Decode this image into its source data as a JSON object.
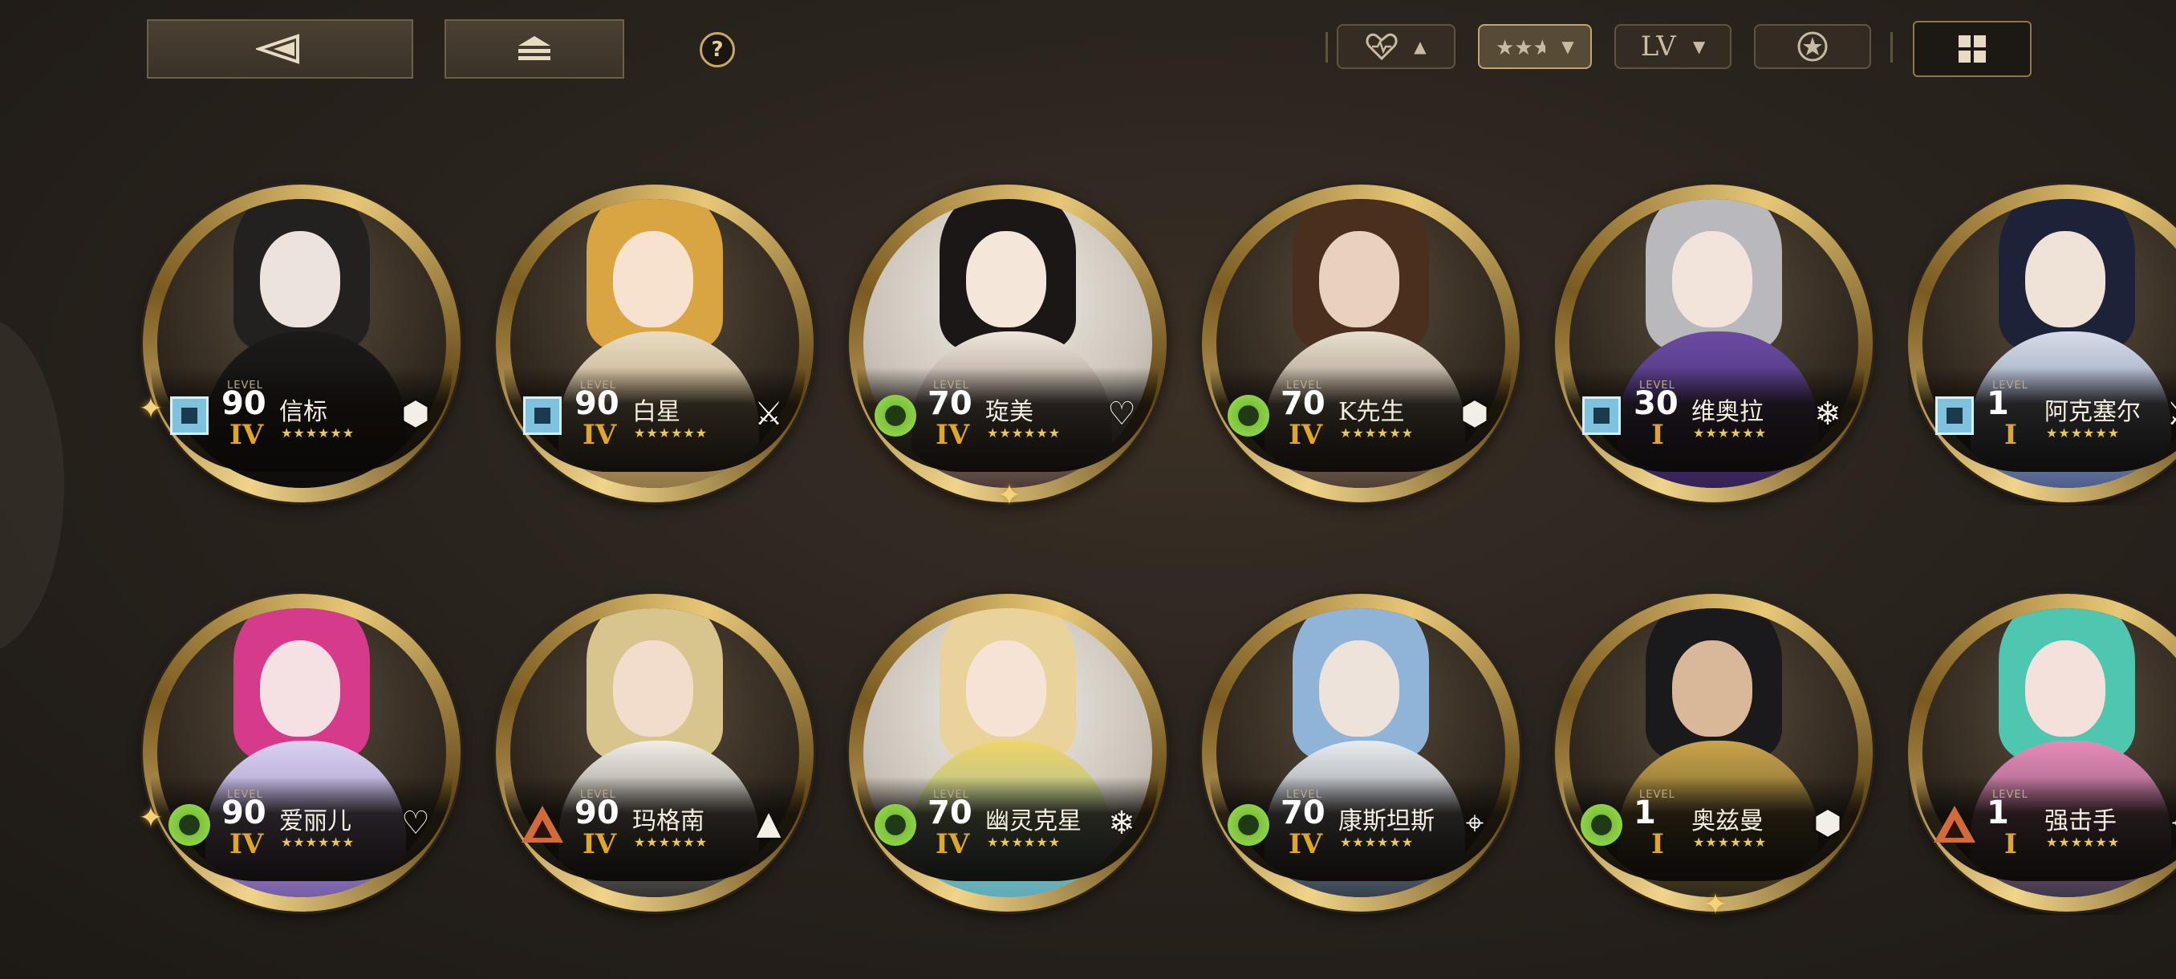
{
  "topbar": {
    "sort_level_label": "LV",
    "icons": {
      "back": "back-arrow-icon",
      "home": "home-stack-icon",
      "help": "help-icon",
      "affinity": "heart-icon",
      "rarity": "stars-icon",
      "type": "star-badge-icon",
      "grid": "grid-view-icon"
    },
    "help_glyph": "?"
  },
  "level_caption": "LEVEL",
  "characters": [
    {
      "name": "信标",
      "level": "90",
      "rank": "IV",
      "stars": "★★★★★★",
      "element": "square",
      "class_icon": "hexagon-icon"
    },
    {
      "name": "白星",
      "level": "90",
      "rank": "IV",
      "stars": "★★★★★★",
      "element": "square",
      "class_icon": "crossed-blades-icon"
    },
    {
      "name": "琁美",
      "level": "70",
      "rank": "IV",
      "stars": "★★★★★★",
      "element": "circle",
      "class_icon": "heart-icon"
    },
    {
      "name": "K先生",
      "level": "70",
      "rank": "IV",
      "stars": "★★★★★★",
      "element": "circle",
      "class_icon": "hexagon-icon"
    },
    {
      "name": "维奥拉",
      "level": "30",
      "rank": "I",
      "stars": "★★★★★★",
      "element": "square",
      "class_icon": "snowflake-icon"
    },
    {
      "name": "阿克塞尔",
      "level": "1",
      "rank": "I",
      "stars": "★★★★★★",
      "element": "square",
      "class_icon": "crossed-blades-icon"
    },
    {
      "name": "爱丽儿",
      "level": "90",
      "rank": "IV",
      "stars": "★★★★★★",
      "element": "circle",
      "class_icon": "heart-icon"
    },
    {
      "name": "玛格南",
      "level": "90",
      "rank": "IV",
      "stars": "★★★★★★",
      "element": "triangle",
      "class_icon": "pyramid-icon"
    },
    {
      "name": "幽灵克星",
      "level": "70",
      "rank": "IV",
      "stars": "★★★★★★",
      "element": "circle",
      "class_icon": "snowflake-icon"
    },
    {
      "name": "康斯坦斯",
      "level": "70",
      "rank": "IV",
      "stars": "★★★★★★",
      "element": "circle",
      "class_icon": "crosshair-icon"
    },
    {
      "name": "奥兹曼",
      "level": "1",
      "rank": "I",
      "stars": "★★★★★★",
      "element": "circle",
      "class_icon": "hexagon-icon"
    },
    {
      "name": "强击手",
      "level": "1",
      "rank": "I",
      "stars": "★★★★★★",
      "element": "triangle",
      "class_icon": "crosshair-icon"
    }
  ],
  "colors": {
    "gold": "#e0a628",
    "ring": "#c9a861",
    "background": "#2a241e"
  }
}
